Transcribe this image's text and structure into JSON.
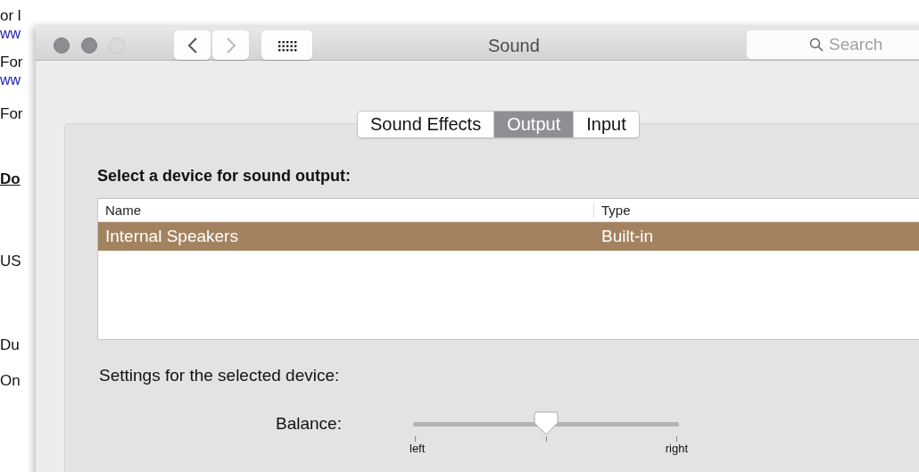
{
  "background_page": {
    "lines": [
      {
        "text": "or l",
        "kind": "text"
      },
      {
        "text": "ww",
        "kind": "link"
      },
      {
        "text": "For",
        "kind": "text"
      },
      {
        "text": "ww",
        "kind": "link"
      },
      {
        "text": "For",
        "kind": "text"
      },
      {
        "text": "Do",
        "kind": "heading"
      },
      {
        "text": "US",
        "kind": "text"
      },
      {
        "text": "Du",
        "kind": "text"
      },
      {
        "text": "On",
        "kind": "text"
      }
    ]
  },
  "window": {
    "title": "Sound",
    "search": {
      "placeholder": "Search"
    }
  },
  "tabs": [
    {
      "label": "Sound Effects",
      "selected": false
    },
    {
      "label": "Output",
      "selected": true
    },
    {
      "label": "Input",
      "selected": false
    }
  ],
  "device_prompt": "Select a device for sound output:",
  "table": {
    "columns": [
      "Name",
      "Type"
    ],
    "rows": [
      {
        "cells": [
          "Internal Speakers",
          "Built-in"
        ],
        "selected": true
      }
    ]
  },
  "settings_label": "Settings for the selected device:",
  "balance": {
    "label": "Balance:",
    "level": 0.5,
    "min_label": "left",
    "max_label": "right"
  }
}
